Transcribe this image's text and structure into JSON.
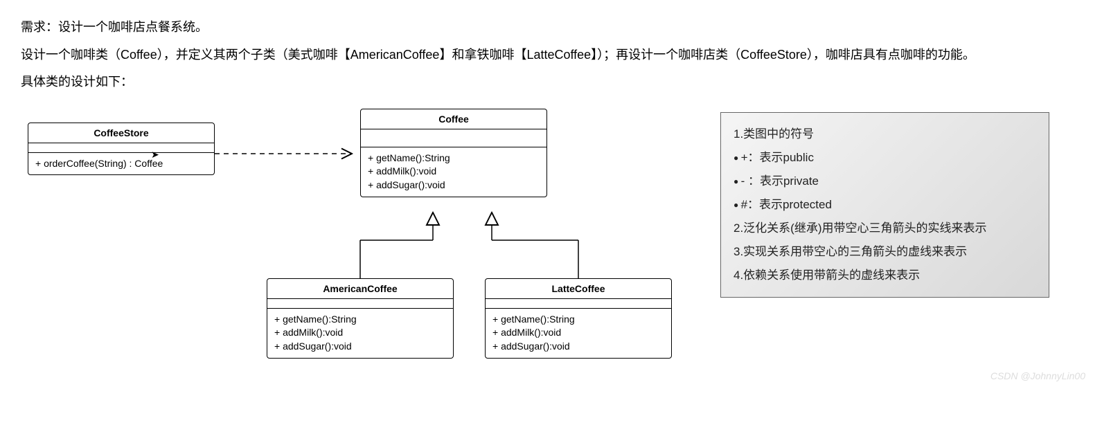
{
  "description": {
    "line1": "需求：设计一个咖啡店点餐系统。",
    "line2": "设计一个咖啡类（Coffee），并定义其两个子类（美式咖啡【AmericanCoffee】和拿铁咖啡【LatteCoffee】）；再设计一个咖啡店类（CoffeeStore），咖啡店具有点咖啡的功能。",
    "line3": "具体类的设计如下："
  },
  "classes": {
    "coffeeStore": {
      "name": "CoffeeStore",
      "methods": "+ orderCoffee(String) : Coffee"
    },
    "coffee": {
      "name": "Coffee",
      "methods": "+ getName():String\n+ addMilk():void\n+ addSugar():void"
    },
    "americanCoffee": {
      "name": "AmericanCoffee",
      "methods": "+ getName():String\n+ addMilk():void\n+ addSugar():void"
    },
    "latteCoffee": {
      "name": "LatteCoffee",
      "methods": "+ getName():String\n+ addMilk():void\n+ addSugar():void"
    }
  },
  "legend": {
    "l1": "1.类图中的符号",
    "b1": "+：表示public",
    "b2": "- ：表示private",
    "b3": "#：表示protected",
    "l2": "2.泛化关系(继承)用带空心三角箭头的实线来表示",
    "l3": "3.实现关系用带空心的三角箭头的虚线来表示",
    "l4": "4.依赖关系使用带箭头的虚线来表示"
  },
  "watermark": "CSDN @JohnnyLin00"
}
